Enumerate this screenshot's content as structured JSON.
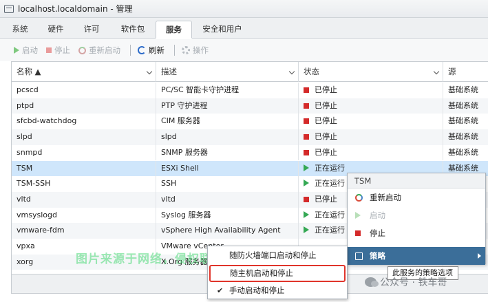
{
  "window": {
    "title": "localhost.localdomain - 管理"
  },
  "tabs": [
    "系统",
    "硬件",
    "许可",
    "软件包",
    "服务",
    "安全和用户"
  ],
  "active_tab": "服务",
  "toolbar": {
    "start": "启动",
    "stop": "停止",
    "restart": "重新启动",
    "refresh": "刷新",
    "actions": "操作"
  },
  "columns": {
    "name": "名称 ▲",
    "description": "描述",
    "status": "状态",
    "source": "源"
  },
  "rows": [
    {
      "name": "pcscd",
      "description": "PC/SC 智能卡守护进程",
      "status": "已停止",
      "state": "stopped",
      "source": "基础系统"
    },
    {
      "name": "ptpd",
      "description": "PTP 守护进程",
      "status": "已停止",
      "state": "stopped",
      "source": "基础系统"
    },
    {
      "name": "sfcbd-watchdog",
      "description": "CIM 服务器",
      "status": "已停止",
      "state": "stopped",
      "source": "基础系统"
    },
    {
      "name": "slpd",
      "description": "slpd",
      "status": "已停止",
      "state": "stopped",
      "source": "基础系统"
    },
    {
      "name": "snmpd",
      "description": "SNMP 服务器",
      "status": "已停止",
      "state": "stopped",
      "source": "基础系统"
    },
    {
      "name": "TSM",
      "description": "ESXi Shell",
      "status": "正在运行",
      "state": "running",
      "source": "基础系统"
    },
    {
      "name": "TSM-SSH",
      "description": "SSH",
      "status": "正在运行",
      "state": "running",
      "source": ""
    },
    {
      "name": "vltd",
      "description": "vltd",
      "status": "已停止",
      "state": "stopped",
      "source": ""
    },
    {
      "name": "vmsyslogd",
      "description": "Syslog 服务器",
      "status": "正在运行",
      "state": "running",
      "source": ""
    },
    {
      "name": "vmware-fdm",
      "description": "vSphere High Availability Agent",
      "status": "正在运行",
      "state": "running",
      "source": ""
    },
    {
      "name": "vpxa",
      "description": "VMware vCenter...",
      "status": "",
      "state": "",
      "source": ""
    },
    {
      "name": "xorg",
      "description": "X.Org 服务器",
      "status": "",
      "state": "",
      "source": ""
    }
  ],
  "context_menu": {
    "header": "TSM",
    "restart": "重新启动",
    "start": "启动",
    "stop": "停止",
    "policy": "策略"
  },
  "tooltip": "此服务的策略选项",
  "policy_submenu": {
    "firewall": "随防火墙端口启动和停止",
    "host": "随主机启动和停止",
    "manual": "手动启动和停止",
    "check": "✔"
  },
  "watermark": "图片来源于网络，侵权联系删除",
  "wechat": "公众号 · 铁车哥"
}
